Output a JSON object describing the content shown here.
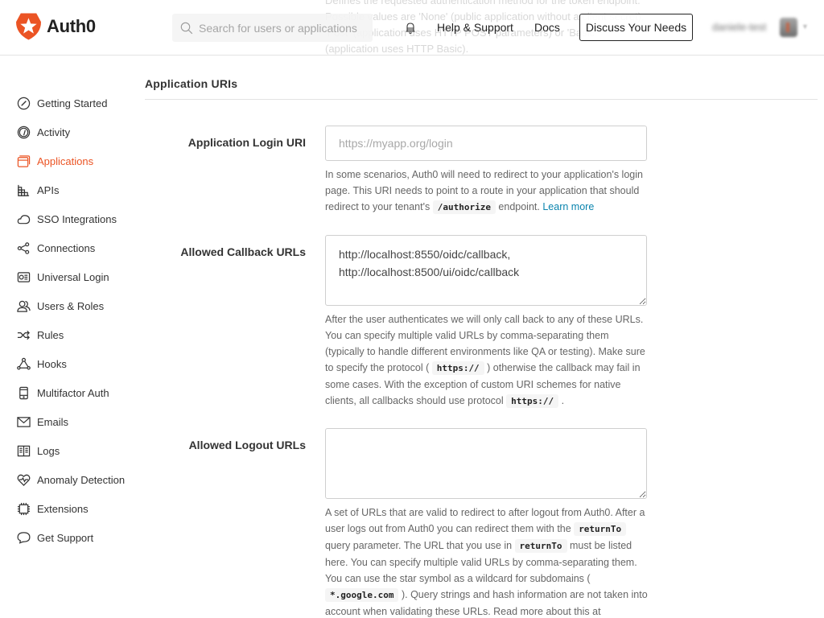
{
  "ghost_lines": [
    "Defines the requested authentication method for the token endpoint.",
    "Possible values are 'None' (public application without a client secret),",
    "'Post' (application uses HTTP POST parameters) or 'Basic'",
    "(application uses HTTP Basic)."
  ],
  "header": {
    "logo_text": "Auth0",
    "search_placeholder": "Search for users or applications",
    "help_label": "Help & Support",
    "docs_label": "Docs",
    "discuss_label": "Discuss Your Needs",
    "user_name": "daniele-test",
    "brand_color": "#eb5424"
  },
  "sidebar": {
    "items": [
      {
        "label": "Getting Started",
        "icon": "compass-icon"
      },
      {
        "label": "Activity",
        "icon": "gauge-icon"
      },
      {
        "label": "Applications",
        "icon": "window-stack-icon",
        "active": true
      },
      {
        "label": "APIs",
        "icon": "grid-blocks-icon"
      },
      {
        "label": "SSO Integrations",
        "icon": "cloud-icon"
      },
      {
        "label": "Connections",
        "icon": "share-nodes-icon"
      },
      {
        "label": "Universal Login",
        "icon": "id-card-icon"
      },
      {
        "label": "Users & Roles",
        "icon": "users-icon"
      },
      {
        "label": "Rules",
        "icon": "shuffle-icon"
      },
      {
        "label": "Hooks",
        "icon": "hooks-triangle-icon"
      },
      {
        "label": "Multifactor Auth",
        "icon": "phone-icon"
      },
      {
        "label": "Emails",
        "icon": "envelope-icon"
      },
      {
        "label": "Logs",
        "icon": "book-icon"
      },
      {
        "label": "Anomaly Detection",
        "icon": "heart-pulse-icon"
      },
      {
        "label": "Extensions",
        "icon": "chip-icon"
      },
      {
        "label": "Get Support",
        "icon": "chat-bubble-icon"
      }
    ]
  },
  "main": {
    "section_title": "Application URIs",
    "login_uri": {
      "label": "Application Login URI",
      "value": "",
      "placeholder": "https://myapp.org/login",
      "help_1": "In some scenarios, Auth0 will need to redirect to your application's login page. This URI needs to point to a route in your application that should redirect to your tenant's ",
      "help_code": "/authorize",
      "help_2": " endpoint. ",
      "help_link": "Learn more"
    },
    "callback_urls": {
      "label": "Allowed Callback URLs",
      "value": "http://localhost:8550/oidc/callback,\nhttp://localhost:8500/ui/oidc/callback",
      "help_1": "After the user authenticates we will only call back to any of these URLs. You can specify multiple valid URLs by comma-separating them (typically to handle different environments like QA or testing). Make sure to specify the protocol ( ",
      "help_code_1": "https://",
      "help_2": " ) otherwise the callback may fail in some cases. With the exception of custom URI schemes for native clients, all callbacks should use protocol ",
      "help_code_2": "https://",
      "help_3": " ."
    },
    "logout_urls": {
      "label": "Allowed Logout URLs",
      "value": "",
      "help_1": "A set of URLs that are valid to redirect to after logout from Auth0. After a user logs out from Auth0 you can redirect them with the ",
      "help_code_1": "returnTo",
      "help_2": " query parameter. The URL that you use in ",
      "help_code_2": "returnTo",
      "help_3": " must be listed here. You can specify multiple valid URLs by comma-separating them. You can use the star symbol as a wildcard for subdomains ( ",
      "help_code_3": "*.google.com",
      "help_4": " ). Query strings and hash information are not taken into account when validating these URLs. Read more about this at"
    }
  }
}
